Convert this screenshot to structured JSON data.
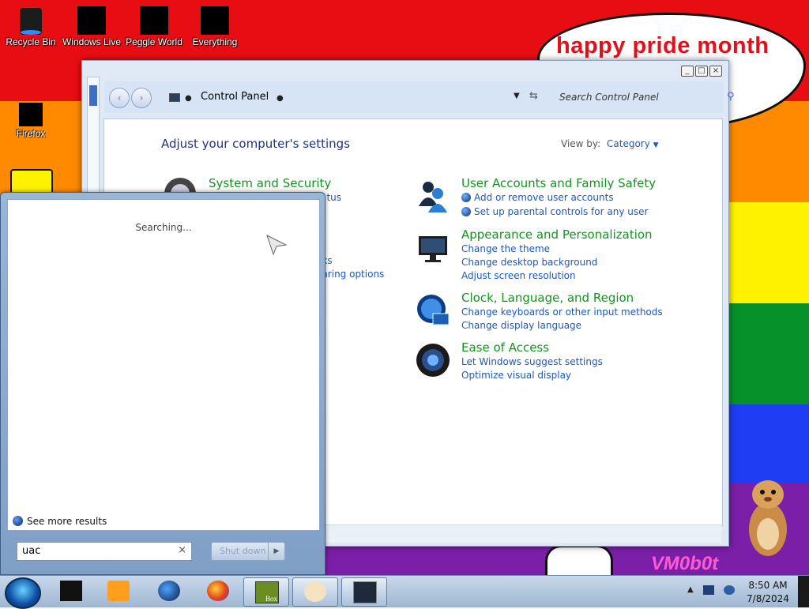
{
  "wallpaper": {
    "speech_text": "happy pride month",
    "stamp_text": "VM0b0t"
  },
  "desktop_icons": [
    {
      "label": "Recycle Bin",
      "icon": "recycle-bin-icon"
    },
    {
      "label": "Windows Live",
      "icon": "windows-live-icon"
    },
    {
      "label": "Peggle World",
      "icon": "peggle-icon"
    },
    {
      "label": "Everything",
      "icon": "everything-icon"
    },
    {
      "label": "Firefox",
      "icon": "firefox-icon"
    }
  ],
  "control_panel": {
    "address": "Control Panel",
    "search_placeholder": "Search Control Panel",
    "heading": "Adjust your computer's settings",
    "view_by_label": "View by:",
    "view_by_value": "Category",
    "categories": {
      "system": {
        "title": "System and Security",
        "links": [
          "...tus"
        ]
      },
      "network": {
        "links": [
          "...ks",
          "...aring options"
        ]
      },
      "user_accounts": {
        "title": "User Accounts and Family Safety",
        "links": [
          "Add or remove user accounts",
          "Set up parental controls for any user"
        ]
      },
      "appearance": {
        "title": "Appearance and Personalization",
        "links": [
          "Change the theme",
          "Change desktop background",
          "Adjust screen resolution"
        ]
      },
      "clock": {
        "title": "Clock, Language, and Region",
        "links": [
          "Change keyboards or other input methods",
          "Change display language"
        ]
      },
      "ease": {
        "title": "Ease of Access",
        "links": [
          "Let Windows suggest settings",
          "Optimize visual display"
        ]
      }
    }
  },
  "start_menu": {
    "status": "Searching...",
    "see_more": "See more results",
    "search_value": "uac",
    "shutdown_label": "Shut down"
  },
  "taskbar": {
    "time": "8:50 AM",
    "date": "7/8/2024",
    "items": [
      "black-app-icon",
      "media-player-icon",
      "globe-app-icon",
      "firefox-icon",
      "box-game-icon",
      "paint-icon",
      "control-panel-icon"
    ],
    "box_label": "Box"
  }
}
